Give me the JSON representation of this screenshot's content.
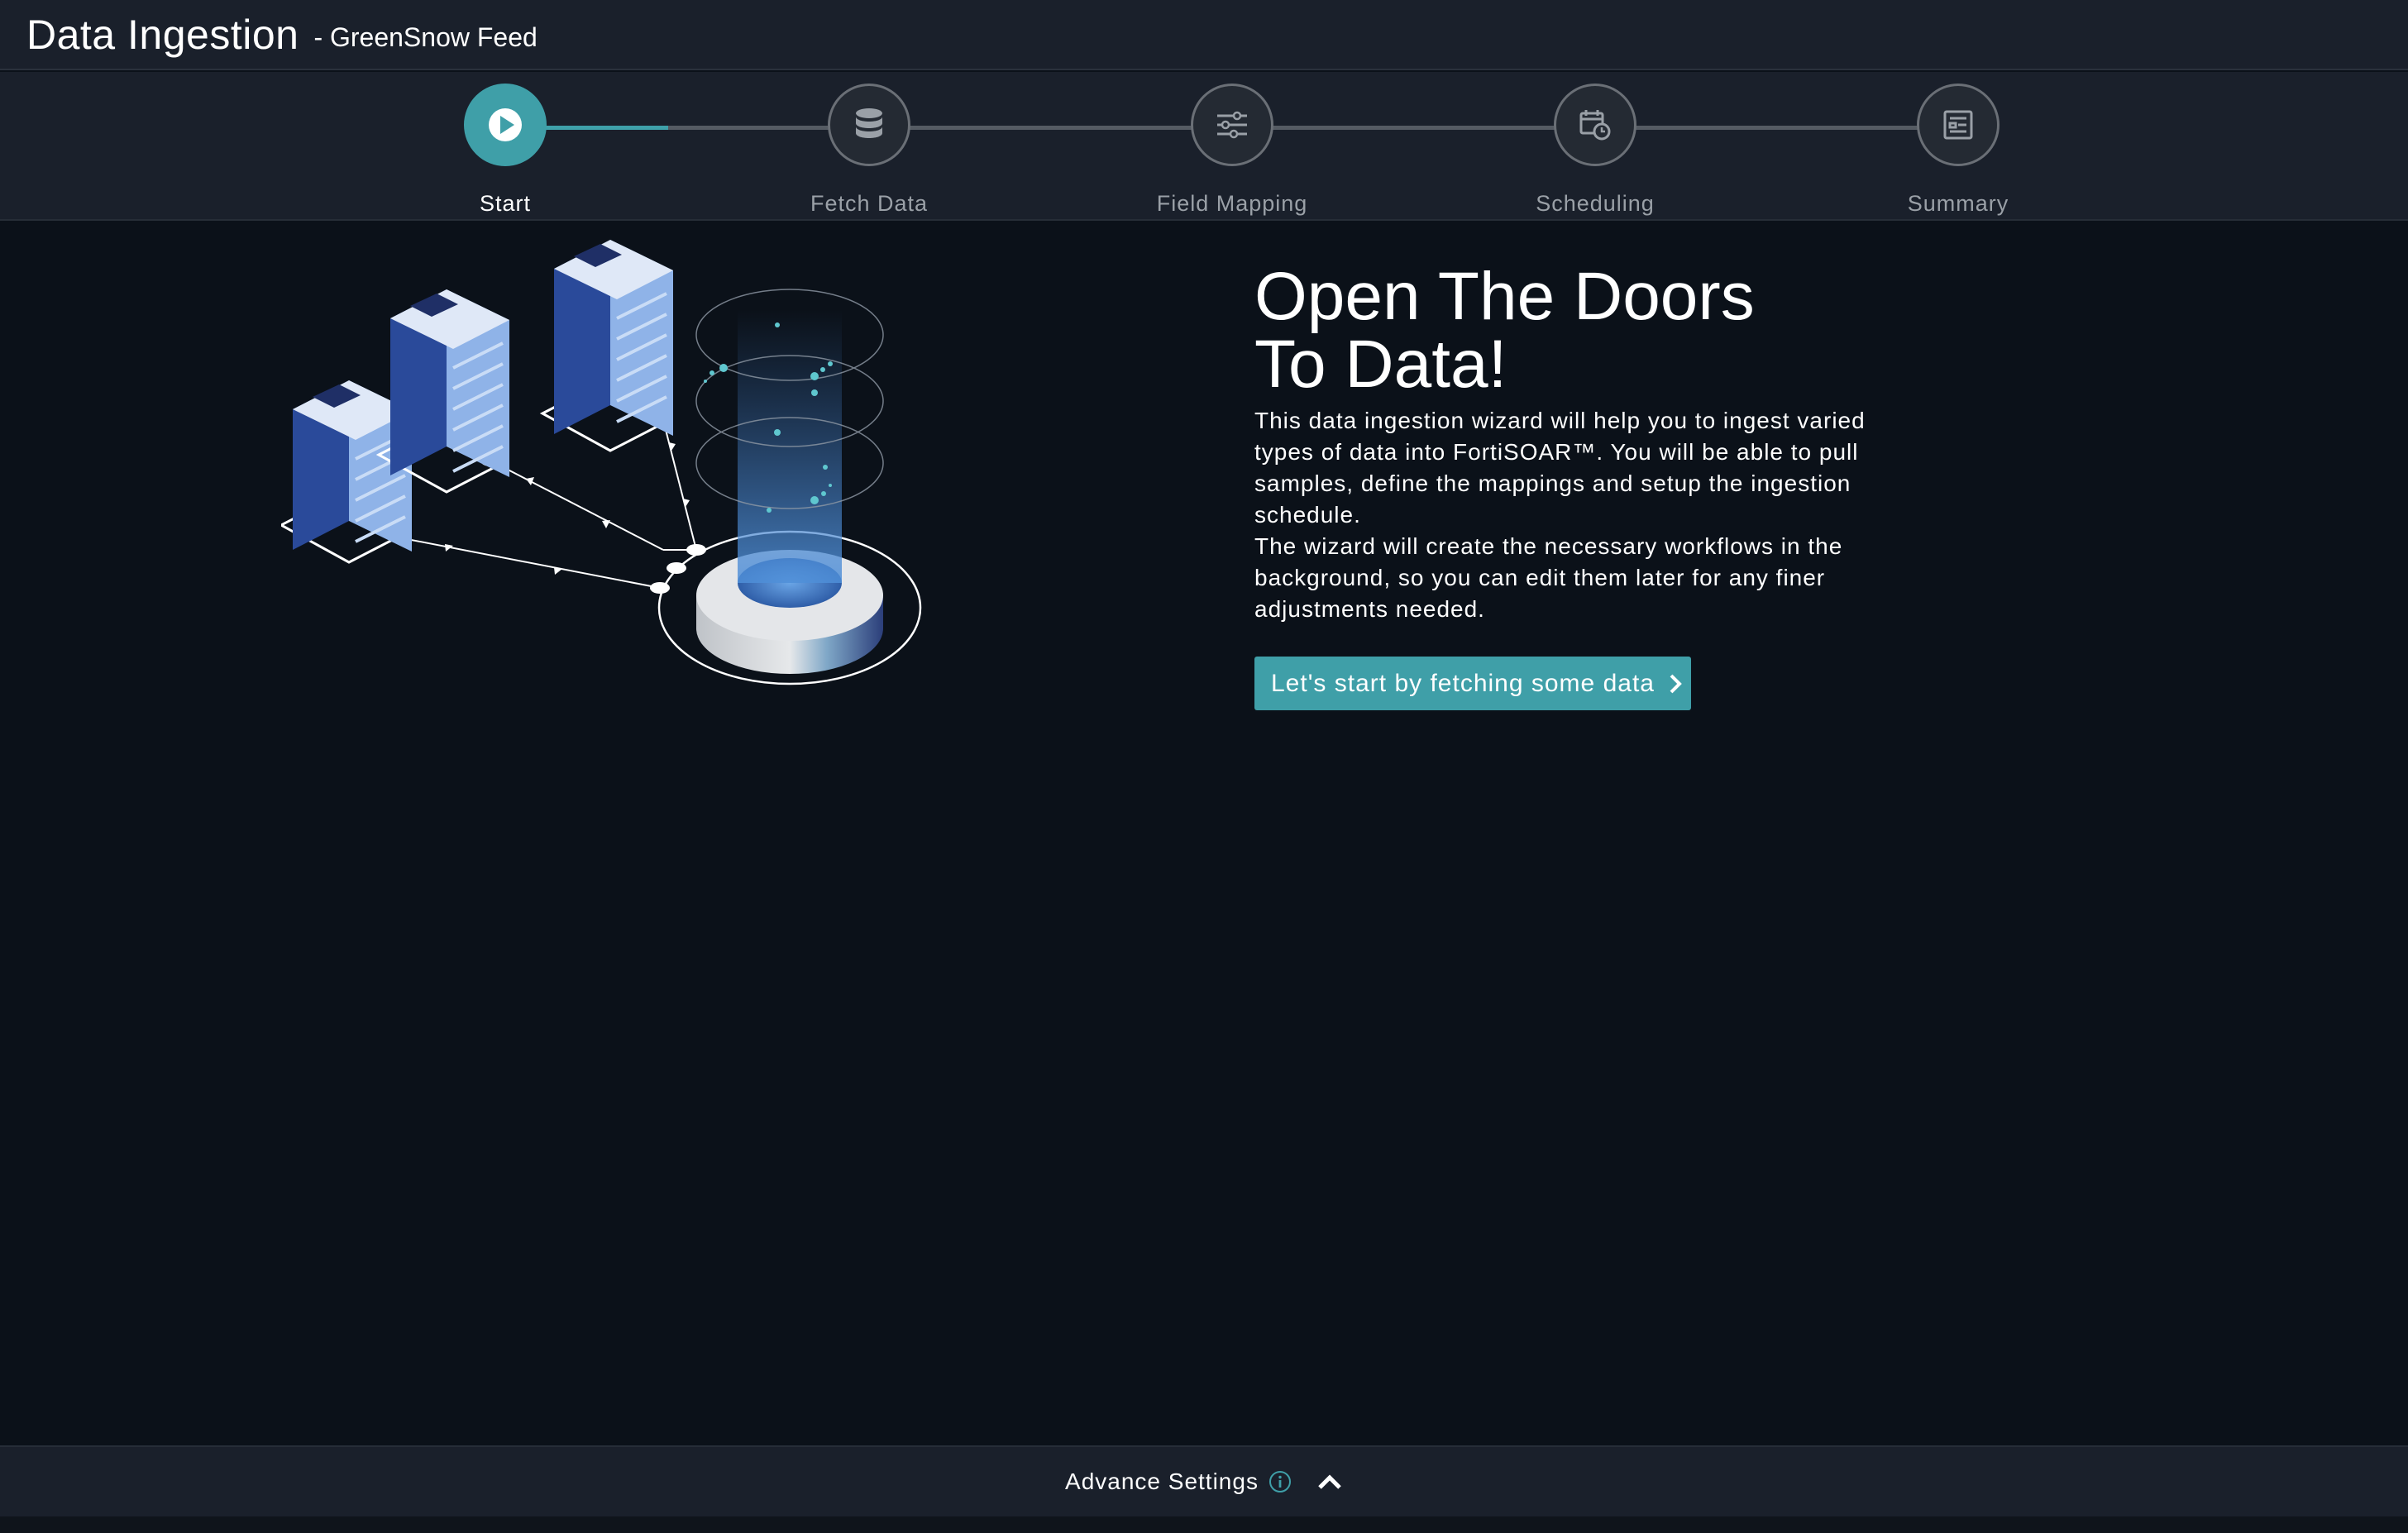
{
  "header": {
    "title": "Data Ingestion",
    "subtitle": "- GreenSnow Feed"
  },
  "stepper": {
    "active_index": 0,
    "progress_fraction": 0.1,
    "steps": [
      {
        "label": "Start",
        "icon": "play-icon"
      },
      {
        "label": "Fetch Data",
        "icon": "database-icon"
      },
      {
        "label": "Field Mapping",
        "icon": "sliders-icon"
      },
      {
        "label": "Scheduling",
        "icon": "calendar-clock-icon"
      },
      {
        "label": "Summary",
        "icon": "document-list-icon"
      }
    ]
  },
  "main": {
    "hero_title": "Open The Doors\nTo Data!",
    "description": [
      "This data ingestion wizard will help you to ingest varied types of data into FortiSOAR™. You will be able to pull samples, define the mappings and setup the ingestion schedule.",
      "The wizard will create the necessary workflows in the background, so you can edit them later for any finer adjustments needed."
    ],
    "cta_label": "Let's start by fetching some data",
    "illustration": "servers-to-database-illustration"
  },
  "footer": {
    "advance_settings_label": "Advance Settings",
    "info_icon": "info-icon",
    "toggle_icon": "chevron-up-icon"
  },
  "colors": {
    "accent": "#3f9fa8",
    "background": "#0b1119",
    "header": "#1a202b"
  }
}
